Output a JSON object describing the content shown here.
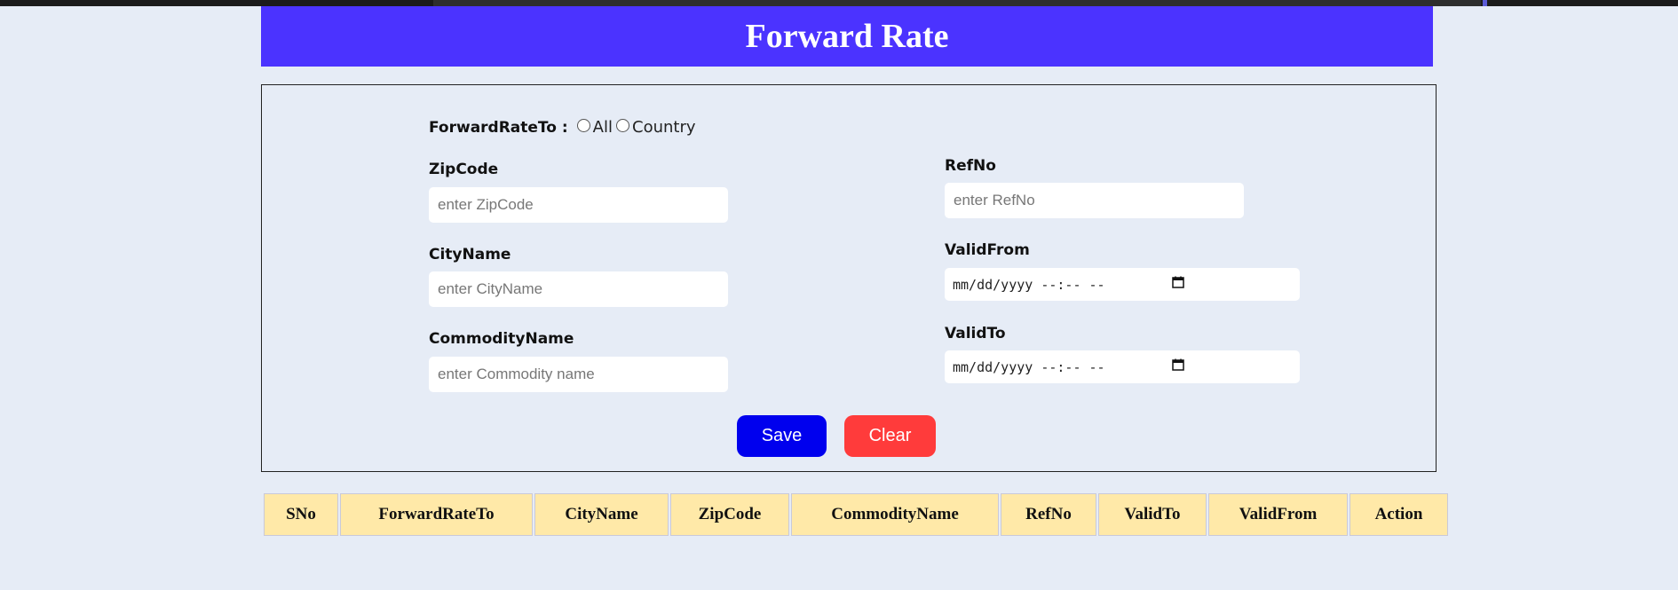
{
  "header": {
    "title": "Forward Rate"
  },
  "form": {
    "forward_rate_to": {
      "label": "ForwardRateTo :",
      "options": [
        "All",
        "Country"
      ]
    },
    "zipcode": {
      "label": "ZipCode",
      "placeholder": "enter ZipCode"
    },
    "cityname": {
      "label": "CityName",
      "placeholder": "enter CityName"
    },
    "commodityname": {
      "label": "CommodityName",
      "placeholder": "enter Commodity name"
    },
    "refno": {
      "label": "RefNo",
      "placeholder": "enter RefNo"
    },
    "validfrom": {
      "label": "ValidFrom",
      "value": "mm/dd/yyyy --:-- --"
    },
    "validto": {
      "label": "ValidTo",
      "value": "mm/dd/yyyy --:-- --"
    },
    "buttons": {
      "save": "Save",
      "clear": "Clear"
    }
  },
  "table": {
    "columns": [
      "SNo",
      "ForwardRateTo",
      "CityName",
      "ZipCode",
      "CommodityName",
      "RefNo",
      "ValidTo",
      "ValidFrom",
      "Action"
    ]
  },
  "icons": {
    "calendar": "calendar-icon"
  },
  "colors": {
    "header_bg": "#4b33ff",
    "save_bg": "#0000ee",
    "clear_bg": "#ff3b3b",
    "table_header_bg": "#ffe9a8",
    "page_bg": "#e6ecf6"
  }
}
